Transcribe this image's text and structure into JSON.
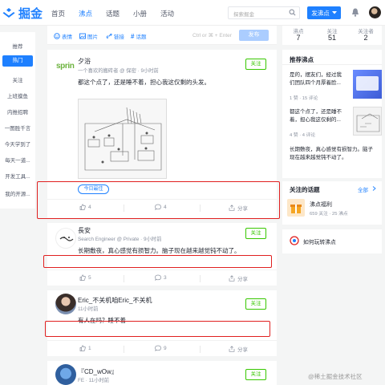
{
  "logo": {
    "text": "掘金"
  },
  "nav": {
    "items": [
      "首页",
      "沸点",
      "话题",
      "小册",
      "活动"
    ]
  },
  "search": {
    "placeholder": "探索掘金"
  },
  "header": {
    "publish_label": "发沸点"
  },
  "sidebar": {
    "items": [
      "推荐",
      "热门",
      "关注",
      "上班摸鱼",
      "内推招聘",
      "一图胜千言",
      "今天学到了",
      "每天一道...",
      "开发工具...",
      "我的开源..."
    ]
  },
  "composer": {
    "tools": [
      "表情",
      "图片",
      "链接",
      "话题"
    ],
    "hint": "Ctrl or ⌘ + Enter",
    "send_label": "发布"
  },
  "follow_label": "关注",
  "posts": [
    {
      "logo_text": "sprin",
      "author": "夕浴",
      "meta": "一个喜欢的搬砖者 @ 保密 · 9小时前",
      "content": "都这个点了，还是睡不着，担心我这仅剩的头发。",
      "tag": "今日最佳",
      "likes": "4",
      "comments": "4",
      "share": "分享"
    },
    {
      "author": "長安",
      "meta": "Search Engineer @ Private · 9小时前",
      "content": "长期敷夜，真心感觉有损智力。脑子现在越来越觉钝不动了。",
      "likes": "5",
      "comments": "3",
      "share": "分享"
    },
    {
      "author": "Eric_不关机咱Eric_不关机",
      "meta": "11小时前",
      "content": "有人在吗？睡不着",
      "likes": "1",
      "comments": "9",
      "share": "分享"
    },
    {
      "author": "『CD_wOw』",
      "meta": "FE · 11小时前"
    }
  ],
  "stats": [
    {
      "label": "沸点",
      "value": "7"
    },
    {
      "label": "关注",
      "value": "51"
    },
    {
      "label": "关注者",
      "value": "2"
    }
  ],
  "recommend": {
    "title": "推荐沸点",
    "items": [
      {
        "text": "是的，摆友们，经过我们团队四个月厚着脸...",
        "meta": "1 赞 · 15 评论"
      },
      {
        "text": "都这个点了，还是睡不着，担心我这仅剩的...",
        "meta": "4 赞 · 4 评论"
      },
      {
        "text": "长期敷夜，真心感觉有损智力。脑子现在越来越觉钝不动了。",
        "meta": ""
      }
    ]
  },
  "topics": {
    "title": "关注的话题",
    "all_label": "全部",
    "items": [
      {
        "name": "沸点福利",
        "meta": "659 关注 · 25 沸点"
      }
    ]
  },
  "guide": {
    "label": "如何玩转沸点"
  },
  "watermark": "@稀土掘金技术社区",
  "colors": {
    "brand": "#1e80ff",
    "follow": "#37c700",
    "highlight": "#e02020"
  }
}
